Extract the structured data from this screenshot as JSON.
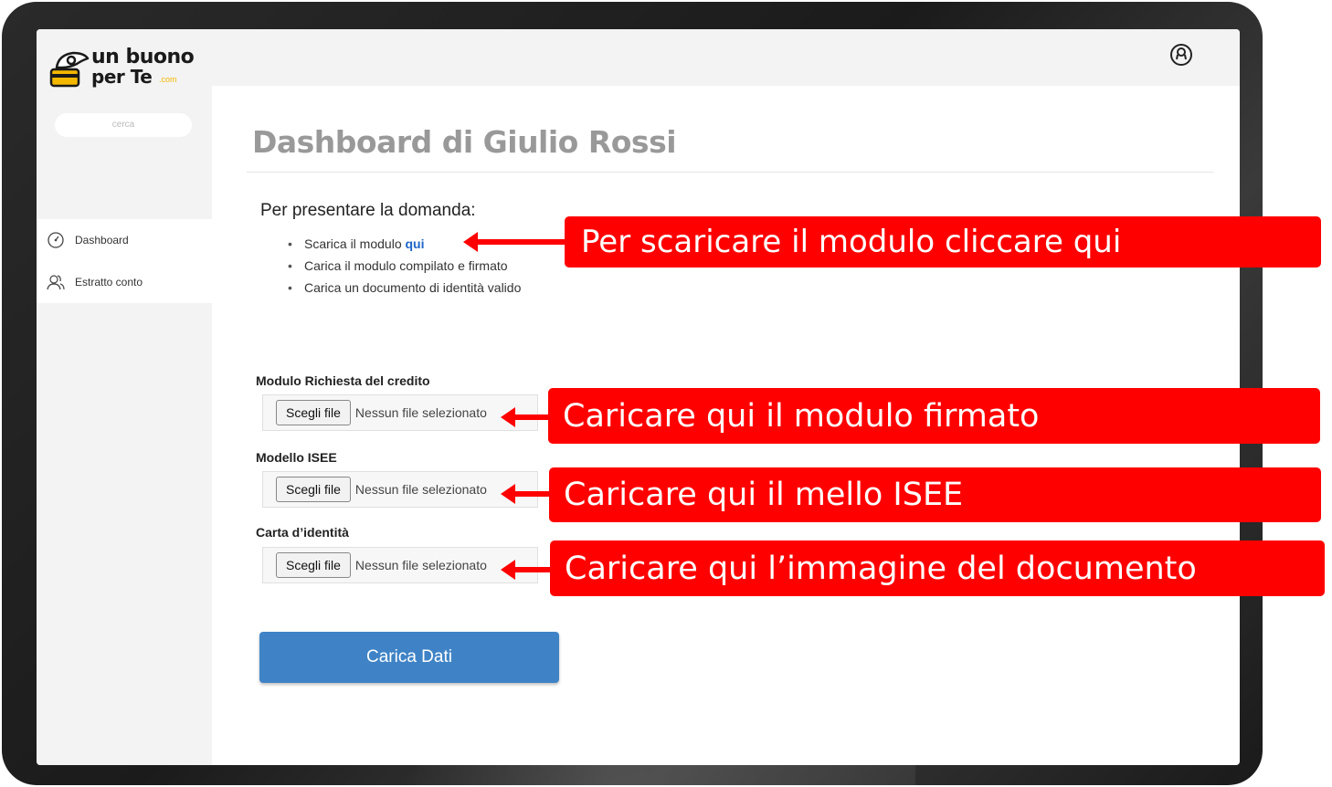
{
  "app": {
    "logo_line1": "un buono",
    "logo_line2": "per Te",
    "logo_tld": ".com"
  },
  "sidebar": {
    "search_placeholder": "cerca",
    "items": [
      {
        "label": "Dashboard",
        "icon": "gauge-icon"
      },
      {
        "label": "Estratto conto",
        "icon": "users-icon"
      }
    ]
  },
  "header": {
    "profile_icon": "user-circle-icon"
  },
  "main": {
    "title": "Dashboard di Giulio Rossi",
    "instructions": {
      "heading": "Per presentare la domanda:",
      "items": [
        {
          "text": "Scarica il modulo ",
          "link": "qui"
        },
        {
          "text": "Carica il modulo compilato e firmato"
        },
        {
          "text": "Carica un documento di identità valido"
        }
      ]
    },
    "fields": [
      {
        "label": "Modulo Richiesta del credito",
        "button": "Scegli file",
        "status": "Nessun file selezionato"
      },
      {
        "label": "Modello ISEE",
        "button": "Scegli file",
        "status": "Nessun file selezionato"
      },
      {
        "label": "Carta d’identità",
        "button": "Scegli file",
        "status": "Nessun file selezionato"
      }
    ],
    "submit_label": "Carica Dati"
  },
  "annotations": [
    "Per scaricare il modulo cliccare qui",
    "Caricare qui il modulo firmato",
    "Caricare qui il mello ISEE",
    "Caricare qui l’immagine del documento"
  ],
  "colors": {
    "annotation": "#ff0000",
    "primary_button": "#3f83c6",
    "link": "#1f66c8",
    "logo_accent": "#f5b800"
  }
}
